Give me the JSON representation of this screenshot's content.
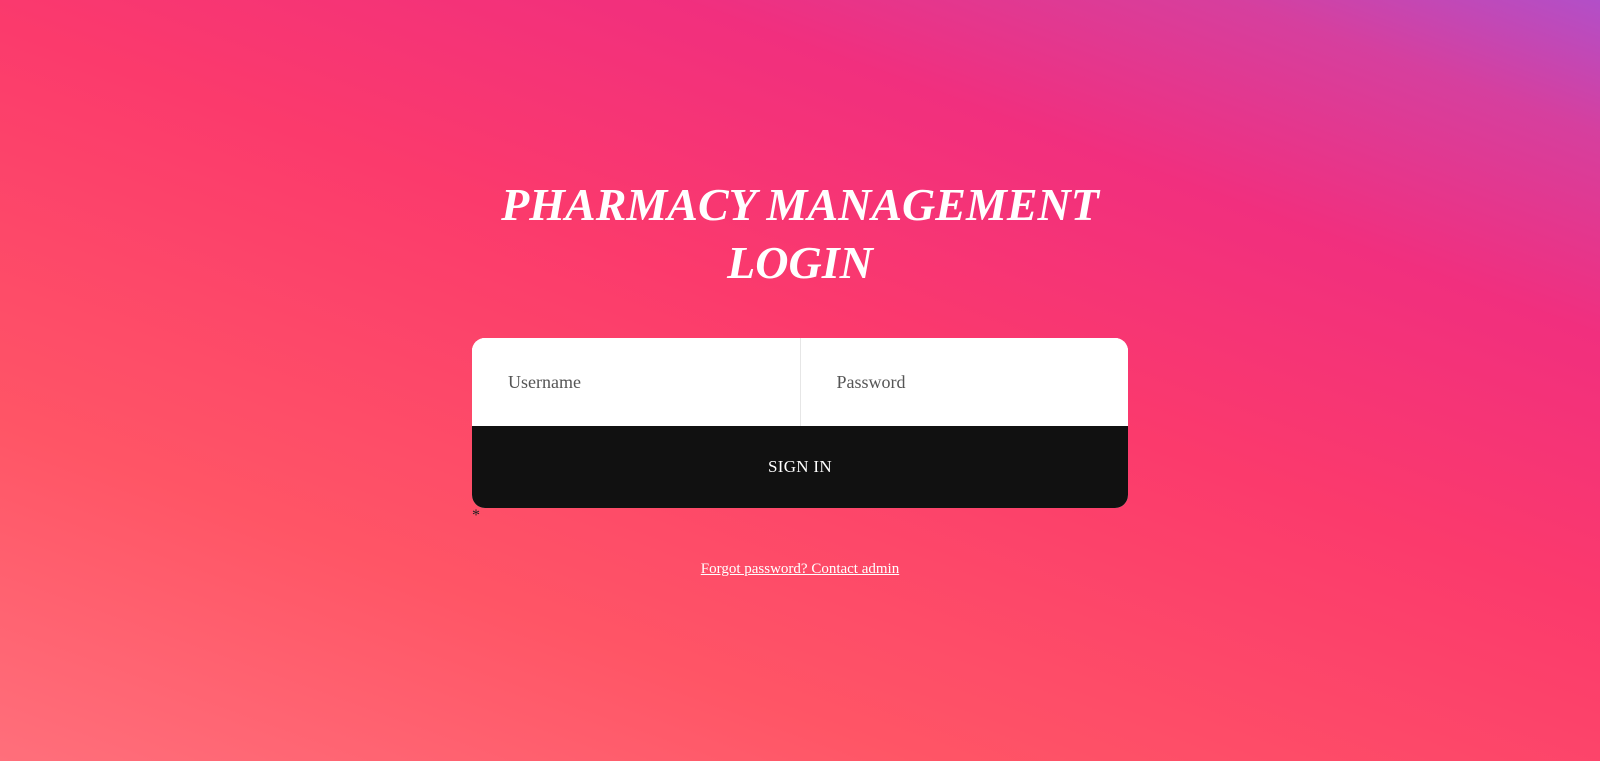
{
  "login": {
    "title_line1": "PHARMACY MANAGEMENT",
    "title_line2": "LOGIN",
    "username_placeholder": "Username",
    "password_placeholder": "Password",
    "sign_in_label": "SIGN IN",
    "required_marker": "*",
    "forgot_link": "Forgot password? Contact admin"
  },
  "colors": {
    "gradient_start": "#ff6f7b",
    "gradient_mid": "#fb3a6c",
    "gradient_end": "#b24fc8",
    "button_bg": "#111111",
    "text_light": "#ffffff"
  }
}
